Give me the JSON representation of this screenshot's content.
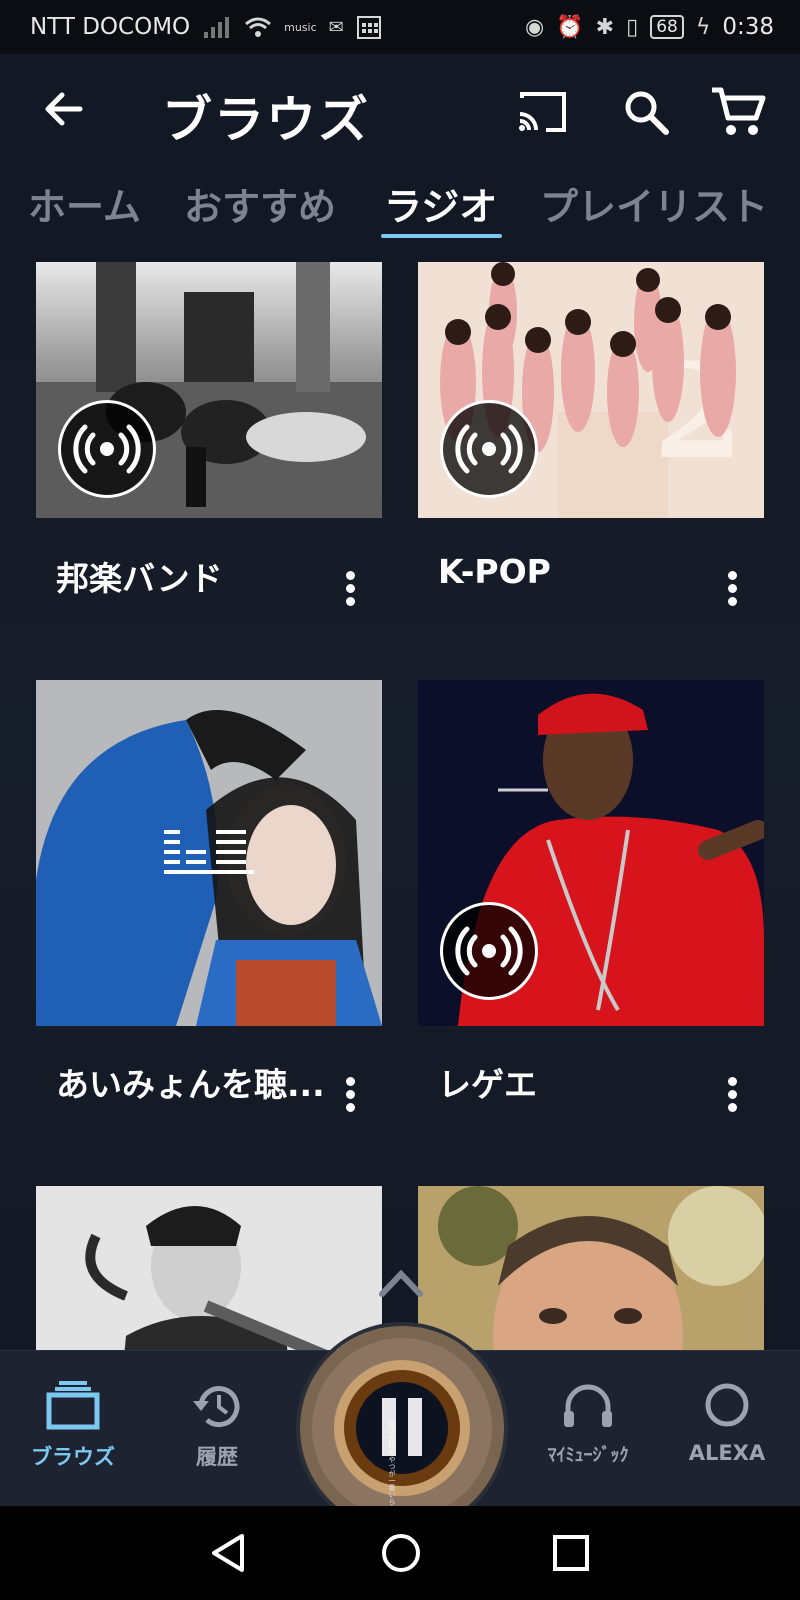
{
  "status_bar": {
    "carrier": "NTT DOCOMO",
    "battery": "68",
    "time": "0:38",
    "music_badge": "music"
  },
  "app_bar": {
    "title": "ブラウズ"
  },
  "tabs": [
    {
      "label": "ホーム",
      "active": false
    },
    {
      "label": "おすすめ",
      "active": false
    },
    {
      "label": "ラジオ",
      "active": true
    },
    {
      "label": "プレイリスト",
      "active": false
    }
  ],
  "stations": [
    {
      "title": "邦楽バンド",
      "badge": "radio-icon"
    },
    {
      "title": "K-POP",
      "badge": "radio-icon"
    },
    {
      "title": "あいみょんを聴...",
      "badge": "playlist-icon"
    },
    {
      "title": "レゲエ",
      "badge": "radio-icon"
    },
    {
      "title": "",
      "badge": ""
    },
    {
      "title": "",
      "badge": ""
    }
  ],
  "bottom_nav": [
    {
      "label": "ブラウズ",
      "icon": "browse-icon",
      "active": true
    },
    {
      "label": "履歴",
      "icon": "history-icon",
      "active": false
    },
    {
      "label": "ﾏｲﾐｭｰｼﾞｯｸ",
      "icon": "headphones-icon",
      "active": false
    },
    {
      "label": "ALEXA",
      "icon": "alexa-icon",
      "active": false
    }
  ],
  "now_playing": {
    "state": "playing",
    "art_text": "負けた時のやつが一番いらない ヨルシカ"
  },
  "colors": {
    "accent": "#7dc8f0",
    "background": "#131924",
    "inactive_tab": "#7b8490"
  }
}
